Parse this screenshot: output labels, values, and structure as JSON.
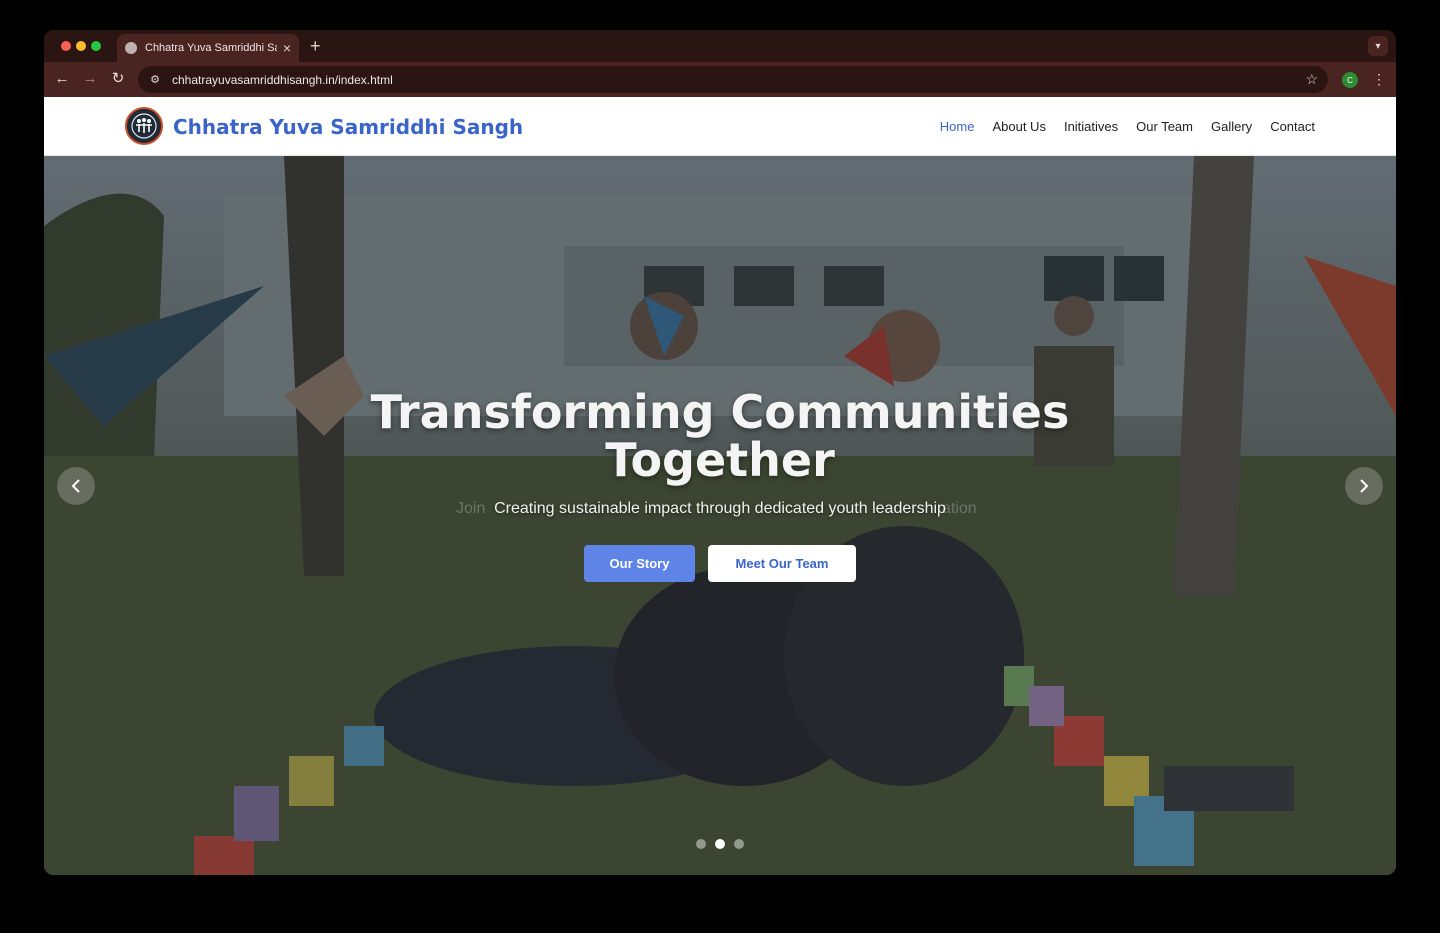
{
  "browser": {
    "tab_title": "Chhatra Yuva Samriddhi Sangh",
    "new_tab": "+",
    "close": "×",
    "url": "chhatrayuvasamriddhisangh.in/index.html",
    "profile_initial": "C"
  },
  "site": {
    "brand": "Chhatra Yuva Samriddhi Sangh",
    "nav": [
      "Home",
      "About Us",
      "Initiatives",
      "Our Team",
      "Gallery",
      "Contact"
    ],
    "active_nav": "Home"
  },
  "hero": {
    "title_line1": "Transforming Communities",
    "title_line2": "Together",
    "subtitle": "Creating sustainable impact through dedicated youth leadership",
    "ghost_left": "Join",
    "ghost_right": "ation",
    "primary_button": "Our Story",
    "secondary_button": "Meet Our Team",
    "slide_count": 3,
    "active_slide": 2
  },
  "colors": {
    "brand": "#3a64c8",
    "primary_button": "#5f84e8",
    "browser_frame": "#2b1512"
  }
}
